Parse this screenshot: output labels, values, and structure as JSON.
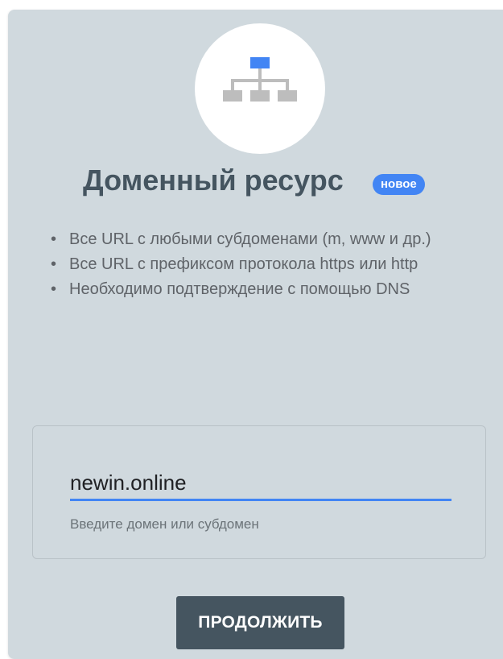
{
  "card": {
    "icon": "sitemap-icon",
    "title": "Доменный ресурс",
    "badge": "новое",
    "features": [
      "Все URL с любыми субдоменами (m, www и др.)",
      "Все URL с префиксом протокола https или http",
      "Необходимо подтверждение с помощью DNS"
    ],
    "domain_input": {
      "value": "newin.online",
      "helper": "Введите домен или субдомен"
    },
    "continue_label": "ПРОДОЛЖИТЬ"
  },
  "colors": {
    "card_background": "#d0d9de",
    "accent": "#4285f4",
    "title_text": "#455560",
    "button_background": "#455560"
  }
}
